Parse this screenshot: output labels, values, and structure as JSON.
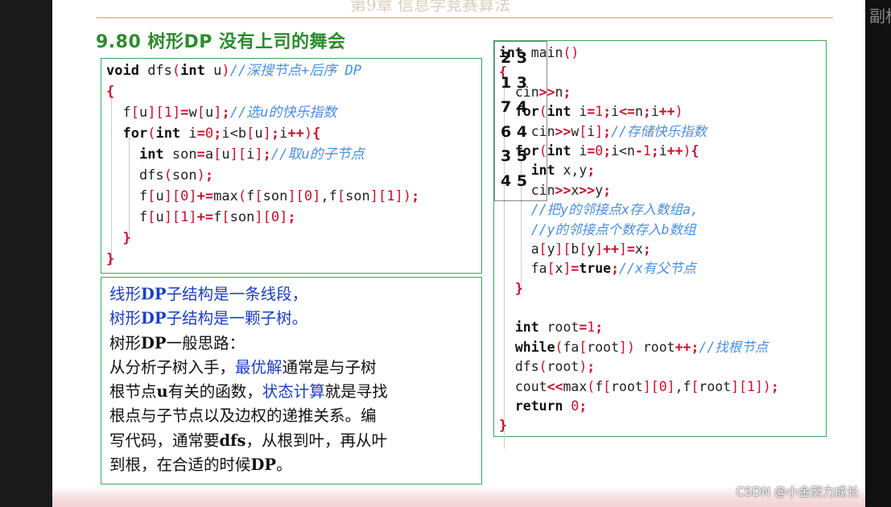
{
  "chapter_title": "第9章 信息学竞赛算法",
  "corner_text": "副标",
  "slide_title": "9.80 树形DP 没有上司的舞会",
  "dfs_code": [
    [
      [
        "kw",
        "void"
      ],
      [
        "txt",
        " dfs"
      ],
      [
        "br",
        "("
      ],
      [
        "kw",
        "int"
      ],
      [
        "txt",
        " u"
      ],
      [
        "br",
        ")"
      ],
      [
        "cm",
        "//深搜节点+后序 DP"
      ]
    ],
    [
      [
        "op",
        "{"
      ]
    ],
    [
      [
        "txt",
        "  f"
      ],
      [
        "br",
        "["
      ],
      [
        "txt",
        "u"
      ],
      [
        "br",
        "]["
      ],
      [
        "num",
        "1"
      ],
      [
        "br",
        "]"
      ],
      [
        "op",
        "="
      ],
      [
        "txt",
        "w"
      ],
      [
        "br",
        "["
      ],
      [
        "txt",
        "u"
      ],
      [
        "br",
        "]"
      ],
      [
        "op",
        ";"
      ],
      [
        "cm",
        "//选u的快乐指数"
      ]
    ],
    [
      [
        "txt",
        "  "
      ],
      [
        "kw",
        "for"
      ],
      [
        "br",
        "("
      ],
      [
        "kw",
        "int"
      ],
      [
        "txt",
        " i"
      ],
      [
        "op",
        "="
      ],
      [
        "num",
        "0"
      ],
      [
        "op",
        ";"
      ],
      [
        "txt",
        "i<b"
      ],
      [
        "br",
        "["
      ],
      [
        "txt",
        "u"
      ],
      [
        "br",
        "]"
      ],
      [
        "op",
        ";"
      ],
      [
        "txt",
        "i"
      ],
      [
        "op",
        "++"
      ],
      [
        "br",
        ")"
      ],
      [
        "op",
        "{"
      ]
    ],
    [
      [
        "txt",
        "    "
      ],
      [
        "kw",
        "int"
      ],
      [
        "txt",
        " son"
      ],
      [
        "op",
        "="
      ],
      [
        "txt",
        "a"
      ],
      [
        "br",
        "["
      ],
      [
        "txt",
        "u"
      ],
      [
        "br",
        "]["
      ],
      [
        "txt",
        "i"
      ],
      [
        "br",
        "]"
      ],
      [
        "op",
        ";"
      ],
      [
        "cm",
        "//取u的子节点"
      ]
    ],
    [
      [
        "txt",
        "    dfs"
      ],
      [
        "br",
        "("
      ],
      [
        "txt",
        "son"
      ],
      [
        "br",
        ")"
      ],
      [
        "op",
        ";"
      ]
    ],
    [
      [
        "txt",
        "    f"
      ],
      [
        "br",
        "["
      ],
      [
        "txt",
        "u"
      ],
      [
        "br",
        "]["
      ],
      [
        "num",
        "0"
      ],
      [
        "br",
        "]"
      ],
      [
        "op",
        "+="
      ],
      [
        "txt",
        "max"
      ],
      [
        "br",
        "("
      ],
      [
        "txt",
        "f"
      ],
      [
        "br",
        "["
      ],
      [
        "txt",
        "son"
      ],
      [
        "br",
        "]["
      ],
      [
        "num",
        "0"
      ],
      [
        "br",
        "]"
      ],
      [
        "txt",
        ",f"
      ],
      [
        "br",
        "["
      ],
      [
        "txt",
        "son"
      ],
      [
        "br",
        "]["
      ],
      [
        "num",
        "1"
      ],
      [
        "br",
        "])"
      ],
      [
        "op",
        ";"
      ]
    ],
    [
      [
        "txt",
        "    f"
      ],
      [
        "br",
        "["
      ],
      [
        "txt",
        "u"
      ],
      [
        "br",
        "]["
      ],
      [
        "num",
        "1"
      ],
      [
        "br",
        "]"
      ],
      [
        "op",
        "+="
      ],
      [
        "txt",
        "f"
      ],
      [
        "br",
        "["
      ],
      [
        "txt",
        "son"
      ],
      [
        "br",
        "]["
      ],
      [
        "num",
        "0"
      ],
      [
        "br",
        "]"
      ],
      [
        "op",
        ";"
      ]
    ],
    [
      [
        "txt",
        "  "
      ],
      [
        "op",
        "}"
      ]
    ],
    [
      [
        "op",
        "}"
      ]
    ]
  ],
  "main_code": [
    [
      [
        "kw",
        "int"
      ],
      [
        "txt",
        " main"
      ],
      [
        "br",
        "()"
      ]
    ],
    [
      [
        "op",
        "{"
      ]
    ],
    [
      [
        "txt",
        "  cin"
      ],
      [
        "op",
        ">>"
      ],
      [
        "txt",
        "n"
      ],
      [
        "op",
        ";"
      ]
    ],
    [
      [
        "txt",
        "  "
      ],
      [
        "kw",
        "for"
      ],
      [
        "br",
        "("
      ],
      [
        "kw",
        "int"
      ],
      [
        "txt",
        " i"
      ],
      [
        "op",
        "="
      ],
      [
        "num",
        "1"
      ],
      [
        "op",
        ";"
      ],
      [
        "txt",
        "i"
      ],
      [
        "op",
        "<="
      ],
      [
        "txt",
        "n"
      ],
      [
        "op",
        ";"
      ],
      [
        "txt",
        "i"
      ],
      [
        "op",
        "++"
      ],
      [
        "br",
        ")"
      ]
    ],
    [
      [
        "txt",
        "    cin"
      ],
      [
        "op",
        ">>"
      ],
      [
        "txt",
        "w"
      ],
      [
        "br",
        "["
      ],
      [
        "txt",
        "i"
      ],
      [
        "br",
        "]"
      ],
      [
        "op",
        ";"
      ],
      [
        "cm",
        "//存储快乐指数"
      ]
    ],
    [
      [
        "txt",
        "  "
      ],
      [
        "kw",
        "for"
      ],
      [
        "br",
        "("
      ],
      [
        "kw",
        "int"
      ],
      [
        "txt",
        " i"
      ],
      [
        "op",
        "="
      ],
      [
        "num",
        "0"
      ],
      [
        "op",
        ";"
      ],
      [
        "txt",
        "i<n"
      ],
      [
        "op",
        "-"
      ],
      [
        "num",
        "1"
      ],
      [
        "op",
        ";"
      ],
      [
        "txt",
        "i"
      ],
      [
        "op",
        "++"
      ],
      [
        "br",
        ")"
      ],
      [
        "op",
        "{"
      ]
    ],
    [
      [
        "txt",
        "    "
      ],
      [
        "kw",
        "int"
      ],
      [
        "txt",
        " x,y"
      ],
      [
        "op",
        ";"
      ]
    ],
    [
      [
        "txt",
        "    cin"
      ],
      [
        "op",
        ">>"
      ],
      [
        "txt",
        "x"
      ],
      [
        "op",
        ">>"
      ],
      [
        "txt",
        "y"
      ],
      [
        "op",
        ";"
      ]
    ],
    [
      [
        "cm",
        "    //把y的邻接点x存入数组a,"
      ]
    ],
    [
      [
        "cm",
        "    //y的邻接点个数存入b数组"
      ]
    ],
    [
      [
        "txt",
        "    a"
      ],
      [
        "br",
        "["
      ],
      [
        "txt",
        "y"
      ],
      [
        "br",
        "]["
      ],
      [
        "txt",
        "b"
      ],
      [
        "br",
        "["
      ],
      [
        "txt",
        "y"
      ],
      [
        "br",
        "]"
      ],
      [
        "op",
        "++"
      ],
      [
        "br",
        "]"
      ],
      [
        "op",
        "="
      ],
      [
        "txt",
        "x"
      ],
      [
        "op",
        ";"
      ]
    ],
    [
      [
        "txt",
        "    fa"
      ],
      [
        "br",
        "["
      ],
      [
        "txt",
        "x"
      ],
      [
        "br",
        "]"
      ],
      [
        "op",
        "="
      ],
      [
        "kw",
        "true"
      ],
      [
        "op",
        ";"
      ],
      [
        "cm",
        "//x有父节点"
      ]
    ],
    [
      [
        "txt",
        "  "
      ],
      [
        "op",
        "}"
      ]
    ],
    [
      [
        "txt",
        ""
      ]
    ],
    [
      [
        "txt",
        "  "
      ],
      [
        "kw",
        "int"
      ],
      [
        "txt",
        " root"
      ],
      [
        "op",
        "="
      ],
      [
        "num",
        "1"
      ],
      [
        "op",
        ";"
      ]
    ],
    [
      [
        "txt",
        "  "
      ],
      [
        "kw",
        "while"
      ],
      [
        "br",
        "("
      ],
      [
        "txt",
        "fa"
      ],
      [
        "br",
        "["
      ],
      [
        "txt",
        "root"
      ],
      [
        "br",
        "])"
      ],
      [
        "txt",
        " root"
      ],
      [
        "op",
        "++;"
      ],
      [
        "cm",
        "//找根节点"
      ]
    ],
    [
      [
        "txt",
        "  dfs"
      ],
      [
        "br",
        "("
      ],
      [
        "txt",
        "root"
      ],
      [
        "br",
        ")"
      ],
      [
        "op",
        ";"
      ]
    ],
    [
      [
        "txt",
        "  cout"
      ],
      [
        "op",
        "<<"
      ],
      [
        "txt",
        "max"
      ],
      [
        "br",
        "("
      ],
      [
        "txt",
        "f"
      ],
      [
        "br",
        "["
      ],
      [
        "txt",
        "root"
      ],
      [
        "br",
        "]["
      ],
      [
        "num",
        "0"
      ],
      [
        "br",
        "]"
      ],
      [
        "txt",
        ",f"
      ],
      [
        "br",
        "["
      ],
      [
        "txt",
        "root"
      ],
      [
        "br",
        "]["
      ],
      [
        "num",
        "1"
      ],
      [
        "br",
        "])"
      ],
      [
        "op",
        ";"
      ]
    ],
    [
      [
        "txt",
        "  "
      ],
      [
        "kw",
        "return"
      ],
      [
        "txt",
        " "
      ],
      [
        "num",
        "0"
      ],
      [
        "op",
        ";"
      ]
    ],
    [
      [
        "op",
        "}"
      ]
    ]
  ],
  "input_lines": [
    "2 3",
    "1 3",
    "7 4",
    "6 4",
    "3 5",
    "4 5"
  ],
  "note": {
    "line1": [
      [
        "blue",
        "线形"
      ],
      [
        "blue b",
        "DP"
      ],
      [
        "blue",
        "子结构是一条线段，"
      ]
    ],
    "line2": [
      [
        "blue",
        "树形"
      ],
      [
        "blue b",
        "DP"
      ],
      [
        "blue",
        "子结构是一颗子树。"
      ]
    ],
    "line3": [
      [
        "",
        "树形"
      ],
      [
        "b",
        "DP"
      ],
      [
        "",
        "一般思路："
      ]
    ],
    "line4": [
      [
        "",
        "从分析子树入手，"
      ],
      [
        "blue",
        "最优解"
      ],
      [
        "",
        "通常是与子树"
      ]
    ],
    "line5": [
      [
        "",
        "根节点"
      ],
      [
        "b",
        "u"
      ],
      [
        "",
        "有关的函数，"
      ],
      [
        "blue",
        "状态计算"
      ],
      [
        "",
        "就是寻找"
      ]
    ],
    "line6": [
      [
        "",
        "根点与子节点以及边权的递推关系。编"
      ]
    ],
    "line7": [
      [
        "",
        "写代码，通常要"
      ],
      [
        "b",
        "dfs"
      ],
      [
        "",
        "，从根到叶，再从叶"
      ]
    ],
    "line8": [
      [
        "",
        "到根，在合适的时候"
      ],
      [
        "b",
        "DP"
      ],
      [
        "",
        "。"
      ]
    ]
  },
  "watermark": "CSDN @小金努力成长"
}
